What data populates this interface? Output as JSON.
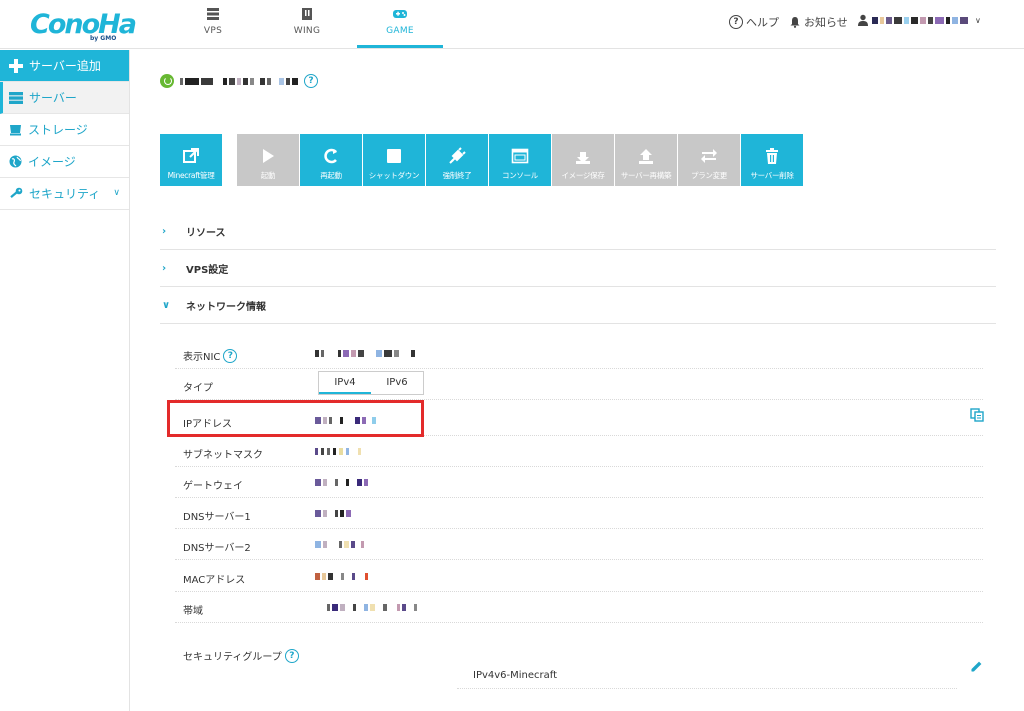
{
  "header": {
    "logo": "ConoHa",
    "logo_sub": "by GMO",
    "nav": [
      {
        "label": "VPS",
        "icon": "server-stack-icon"
      },
      {
        "label": "WING",
        "icon": "wing-icon"
      },
      {
        "label": "GAME",
        "icon": "gamepad-icon"
      }
    ],
    "help_label": "ヘルプ",
    "notice_label": "お知らせ"
  },
  "sidebar": {
    "items": [
      {
        "label": "サーバー追加",
        "icon": "plus-icon"
      },
      {
        "label": "サーバー",
        "icon": "server-icon"
      },
      {
        "label": "ストレージ",
        "icon": "storage-icon"
      },
      {
        "label": "イメージ",
        "icon": "globe-icon"
      },
      {
        "label": "セキュリティ",
        "icon": "key-icon"
      }
    ]
  },
  "toolbar": {
    "buttons": [
      {
        "label": "Minecraft管理",
        "enabled": true
      },
      {
        "label": "起動",
        "enabled": false
      },
      {
        "label": "再起動",
        "enabled": true
      },
      {
        "label": "シャットダウン",
        "enabled": true
      },
      {
        "label": "強制終了",
        "enabled": true
      },
      {
        "label": "コンソール",
        "enabled": true
      },
      {
        "label": "イメージ保存",
        "enabled": false
      },
      {
        "label": "サーバー再構築",
        "enabled": false
      },
      {
        "label": "プラン変更",
        "enabled": false
      },
      {
        "label": "サーバー削除",
        "enabled": true
      }
    ]
  },
  "sections": {
    "resource": "リソース",
    "vps": "VPS設定",
    "network": "ネットワーク情報"
  },
  "network": {
    "nic_label": "表示NIC",
    "type_label": "タイプ",
    "ipv4_tab": "IPv4",
    "ipv6_tab": "IPv6",
    "ip_label": "IPアドレス",
    "subnet_label": "サブネットマスク",
    "gateway_label": "ゲートウェイ",
    "dns1_label": "DNSサーバー1",
    "dns2_label": "DNSサーバー2",
    "mac_label": "MACアドレス",
    "bandwidth_label": "帯域",
    "sg_label": "セキュリティグループ",
    "sg_value": "IPv4v6-Minecraft"
  },
  "colors": {
    "accent": "#1fb5d8",
    "disabled": "#c8c8c8",
    "highlight": "#e32a2a",
    "status": "#67b832"
  }
}
